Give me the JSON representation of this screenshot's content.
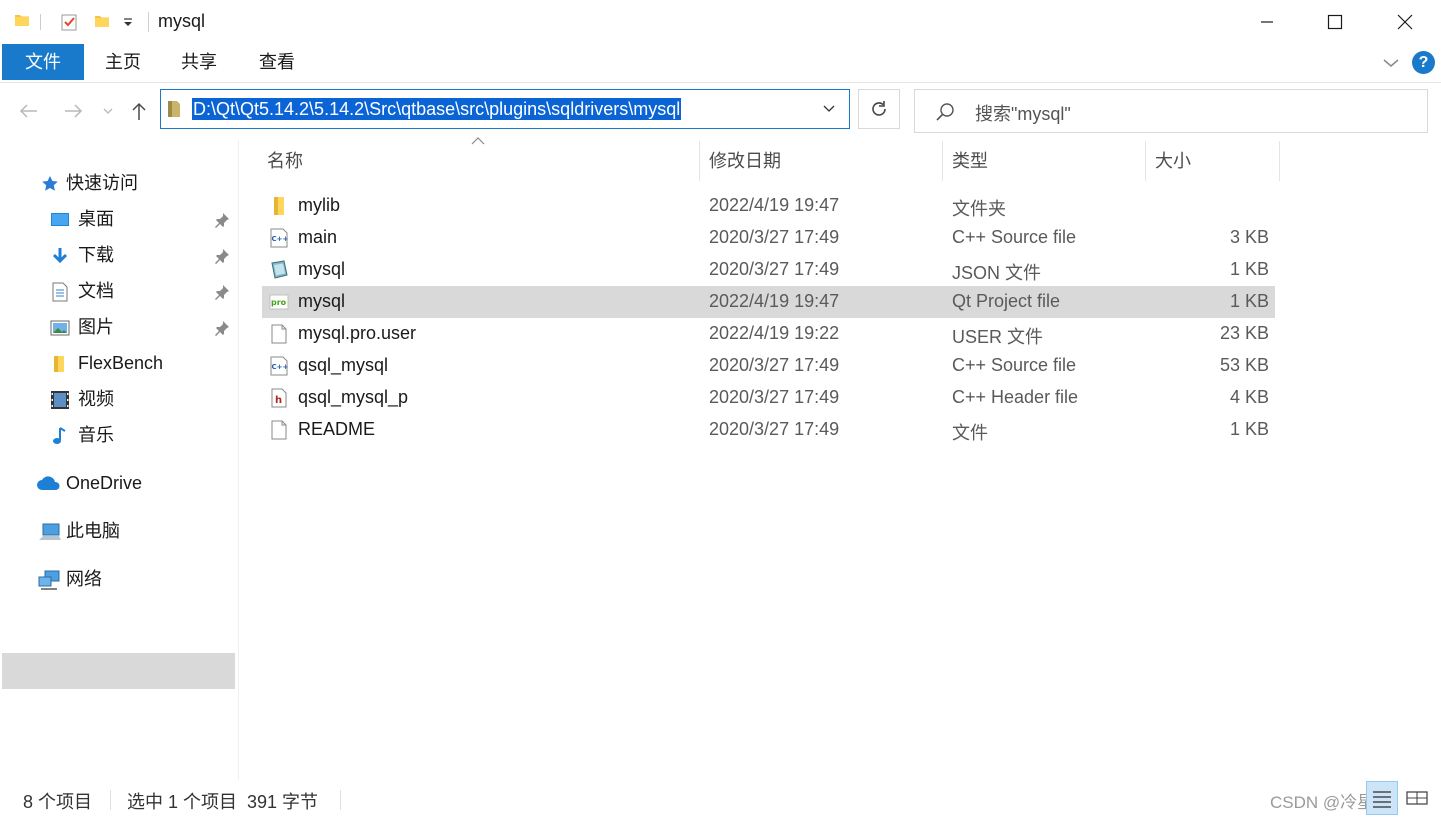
{
  "window": {
    "title": "mysql"
  },
  "ribbon": {
    "tabs": [
      "文件",
      "主页",
      "共享",
      "查看"
    ]
  },
  "address": {
    "path": "D:\\Qt\\Qt5.14.2\\5.14.2\\Src\\qtbase\\src\\plugins\\sqldrivers\\mysql"
  },
  "search": {
    "placeholder": "搜索\"mysql\""
  },
  "sidebar": {
    "items": [
      {
        "label": "快速访问",
        "icon": "star-icon"
      },
      {
        "label": "桌面",
        "icon": "desktop-icon",
        "pinned": true
      },
      {
        "label": "下载",
        "icon": "download-icon",
        "pinned": true
      },
      {
        "label": "文档",
        "icon": "document-icon",
        "pinned": true
      },
      {
        "label": "图片",
        "icon": "pictures-icon",
        "pinned": true
      },
      {
        "label": "FlexBench",
        "icon": "folder-icon"
      },
      {
        "label": "视频",
        "icon": "video-icon"
      },
      {
        "label": "音乐",
        "icon": "music-icon"
      },
      {
        "label": "OneDrive",
        "icon": "cloud-icon"
      },
      {
        "label": "此电脑",
        "icon": "computer-icon",
        "selected": true
      },
      {
        "label": "网络",
        "icon": "network-icon"
      }
    ]
  },
  "columns": {
    "name": "名称",
    "date": "修改日期",
    "type": "类型",
    "size": "大小"
  },
  "files": [
    {
      "name": "mylib",
      "date": "2022/4/19 19:47",
      "type": "文件夹",
      "size": "",
      "icon": "folder-icon"
    },
    {
      "name": "main",
      "date": "2020/3/27 17:49",
      "type": "C++ Source file",
      "size": "3 KB",
      "icon": "cpp-file-icon"
    },
    {
      "name": "mysql",
      "date": "2020/3/27 17:49",
      "type": "JSON 文件",
      "size": "1 KB",
      "icon": "json-file-icon"
    },
    {
      "name": "mysql",
      "date": "2022/4/19 19:47",
      "type": "Qt Project file",
      "size": "1 KB",
      "icon": "pro-file-icon",
      "selected": true
    },
    {
      "name": "mysql.pro.user",
      "date": "2022/4/19 19:22",
      "type": "USER 文件",
      "size": "23 KB",
      "icon": "blank-file-icon"
    },
    {
      "name": "qsql_mysql",
      "date": "2020/3/27 17:49",
      "type": "C++ Source file",
      "size": "53 KB",
      "icon": "cpp-file-icon"
    },
    {
      "name": "qsql_mysql_p",
      "date": "2020/3/27 17:49",
      "type": "C++ Header file",
      "size": "4 KB",
      "icon": "header-file-icon"
    },
    {
      "name": "README",
      "date": "2020/3/27 17:49",
      "type": "文件",
      "size": "1 KB",
      "icon": "blank-file-icon"
    }
  ],
  "status": {
    "item_count": "8 个项目",
    "selection": "选中 1 个项目  391 字节",
    "watermark": "CSDN @冷星星"
  },
  "colors": {
    "accent": "#1979ca",
    "selection": "#d9d9d9",
    "address_highlight": "#0a64d6"
  }
}
